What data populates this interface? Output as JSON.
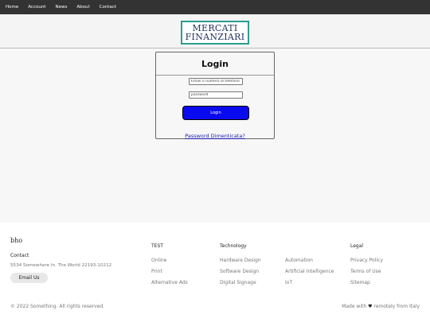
{
  "nav": {
    "items": [
      "Home",
      "Account",
      "News",
      "About",
      "Contact"
    ]
  },
  "logo": {
    "line1": "MERCATI",
    "line2": "FINANZIARI"
  },
  "login": {
    "title": "Login",
    "email_placeholder": "Email o numero di telefono",
    "password_placeholder": "password",
    "button_label": "Login",
    "forgot_link": "Password Dimenticata?"
  },
  "footer": {
    "brand": "bho",
    "contact_title": "Contact",
    "address": "5534 Somewhere In. The World 22193-10212",
    "email_button": "Email Us",
    "col_test": {
      "title": "TEST",
      "links": [
        "Online",
        "Print",
        "Alternative Ads"
      ]
    },
    "col_technology": {
      "title": "Technology",
      "links_a": [
        "Hardware Design",
        "Software Design",
        "Digital Signage"
      ],
      "links_b": [
        "Automation",
        "Artificial Intelligence",
        "IoT"
      ]
    },
    "col_legal": {
      "title": "Legal",
      "links": [
        "Privacy Policy",
        "Terms of Use",
        "Sitemap"
      ]
    },
    "copyright": "© 2022 Something. All rights reserved.",
    "made_with_prefix": "Made with",
    "heart": "♥",
    "made_with_suffix": "remotely from Italy"
  },
  "colors": {
    "nav_bg": "#333333",
    "login_button": "#0a0aee",
    "logo_border": "#2a9d8f",
    "logo_text": "#1f2d5c"
  }
}
